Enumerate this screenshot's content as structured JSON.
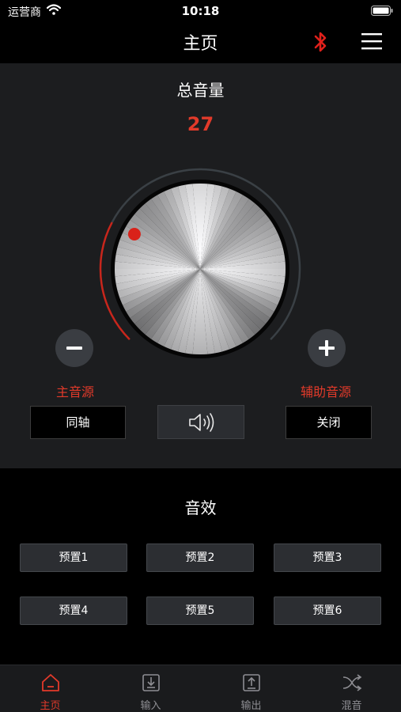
{
  "status_bar": {
    "carrier": "运营商",
    "time": "10:18"
  },
  "header": {
    "title": "主页"
  },
  "volume": {
    "title": "总音量",
    "value": "27",
    "level_fraction": 0.27,
    "main_source_label": "主音源",
    "main_source_value": "同轴",
    "aux_source_label": "辅助音源",
    "aux_source_value": "关闭"
  },
  "effects": {
    "title": "音效",
    "presets": [
      "预置1",
      "预置2",
      "预置3",
      "预置4",
      "预置5",
      "预置6"
    ]
  },
  "tabs": [
    {
      "label": "主页",
      "icon": "home-icon",
      "active": true
    },
    {
      "label": "输入",
      "icon": "input-icon",
      "active": false
    },
    {
      "label": "输出",
      "icon": "output-icon",
      "active": false
    },
    {
      "label": "混音",
      "icon": "mix-icon",
      "active": false
    }
  ],
  "colors": {
    "accent": "#e23a2a",
    "panel": "#1c1d1f",
    "background": "#000000",
    "bluetooth": "#e0201b"
  }
}
